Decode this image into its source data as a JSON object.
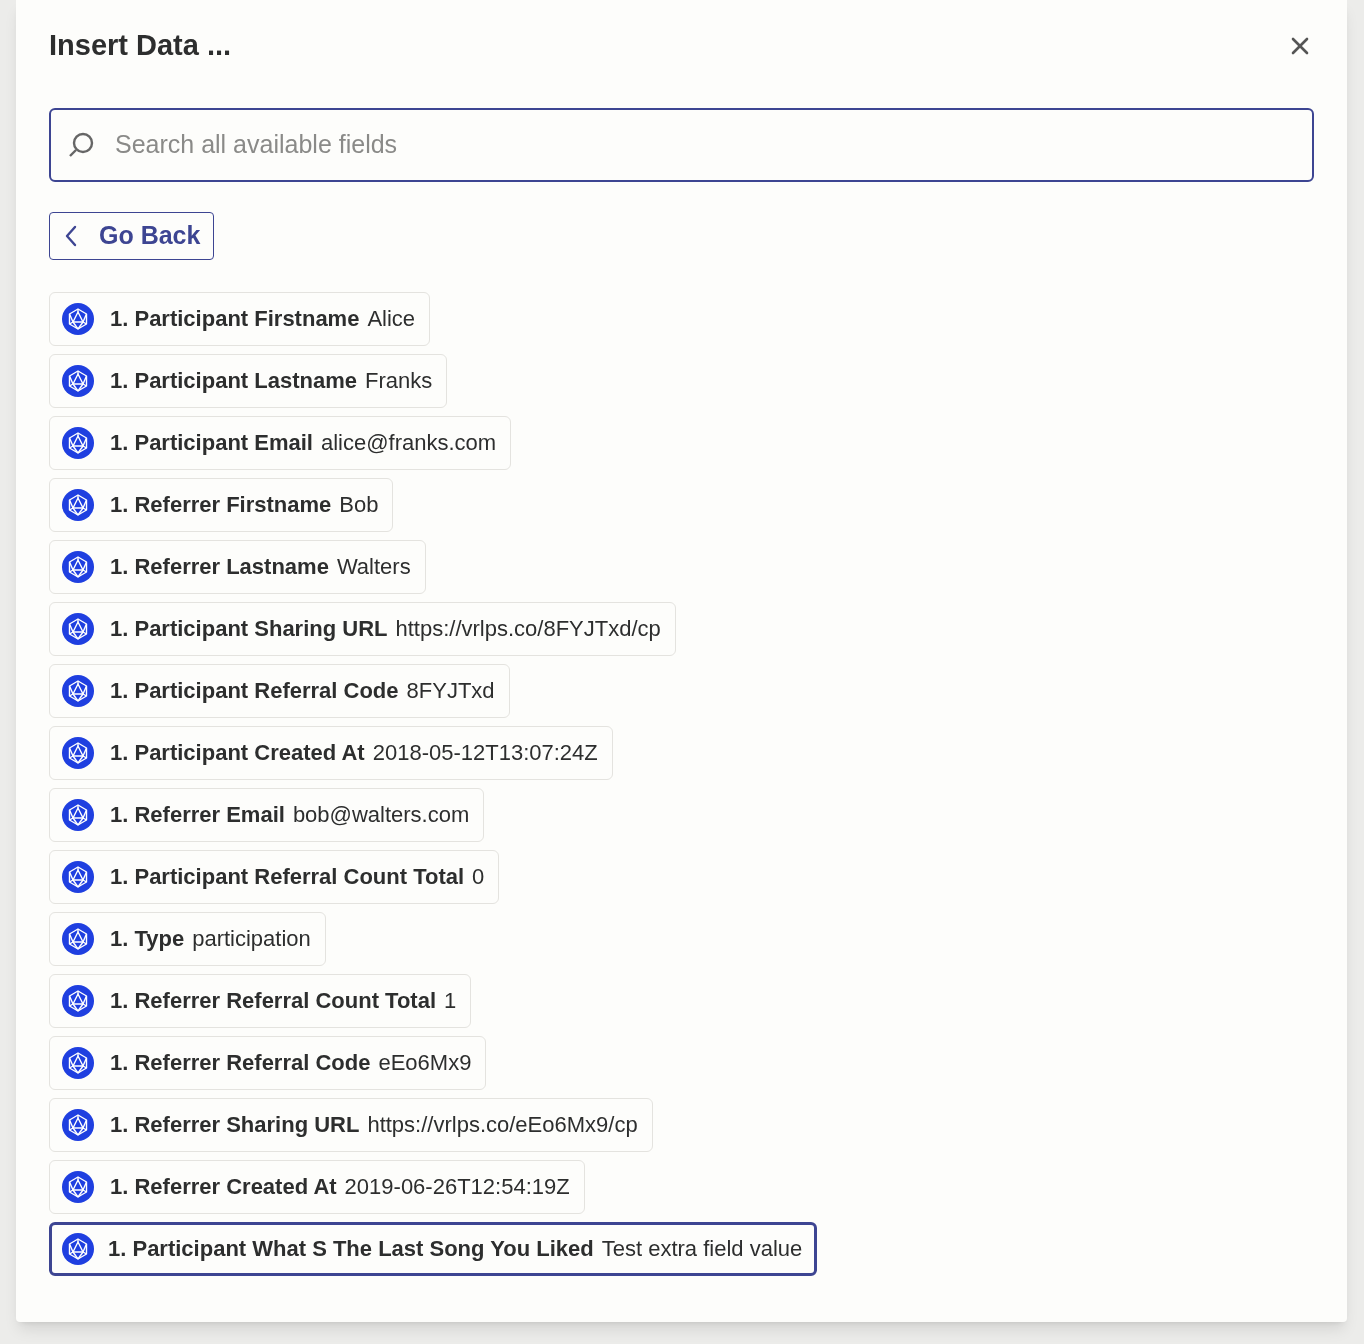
{
  "dialog": {
    "title": "Insert Data ...",
    "search": {
      "placeholder": "Search all available fields"
    },
    "back_button": "Go Back",
    "fields": [
      {
        "label": "1. Participant Firstname",
        "value": "Alice",
        "selected": false
      },
      {
        "label": "1. Participant Lastname",
        "value": "Franks",
        "selected": false
      },
      {
        "label": "1. Participant Email",
        "value": "alice@franks.com",
        "selected": false
      },
      {
        "label": "1. Referrer Firstname",
        "value": "Bob",
        "selected": false
      },
      {
        "label": "1. Referrer Lastname",
        "value": "Walters",
        "selected": false
      },
      {
        "label": "1. Participant Sharing URL",
        "value": "https://vrlps.co/8FYJTxd/cp",
        "selected": false
      },
      {
        "label": "1. Participant Referral Code",
        "value": "8FYJTxd",
        "selected": false
      },
      {
        "label": "1. Participant Created At",
        "value": "2018-05-12T13:07:24Z",
        "selected": false
      },
      {
        "label": "1. Referrer Email",
        "value": "bob@walters.com",
        "selected": false
      },
      {
        "label": "1. Participant Referral Count Total",
        "value": "0",
        "selected": false
      },
      {
        "label": "1. Type",
        "value": "participation",
        "selected": false
      },
      {
        "label": "1. Referrer Referral Count Total",
        "value": "1",
        "selected": false
      },
      {
        "label": "1. Referrer Referral Code",
        "value": "eEo6Mx9",
        "selected": false
      },
      {
        "label": "1. Referrer Sharing URL",
        "value": "https://vrlps.co/eEo6Mx9/cp",
        "selected": false
      },
      {
        "label": "1. Referrer Created At",
        "value": "2019-06-26T12:54:19Z",
        "selected": false
      },
      {
        "label": "1. Participant What S The Last Song You Liked",
        "value": "Test extra field value",
        "selected": true
      }
    ]
  }
}
